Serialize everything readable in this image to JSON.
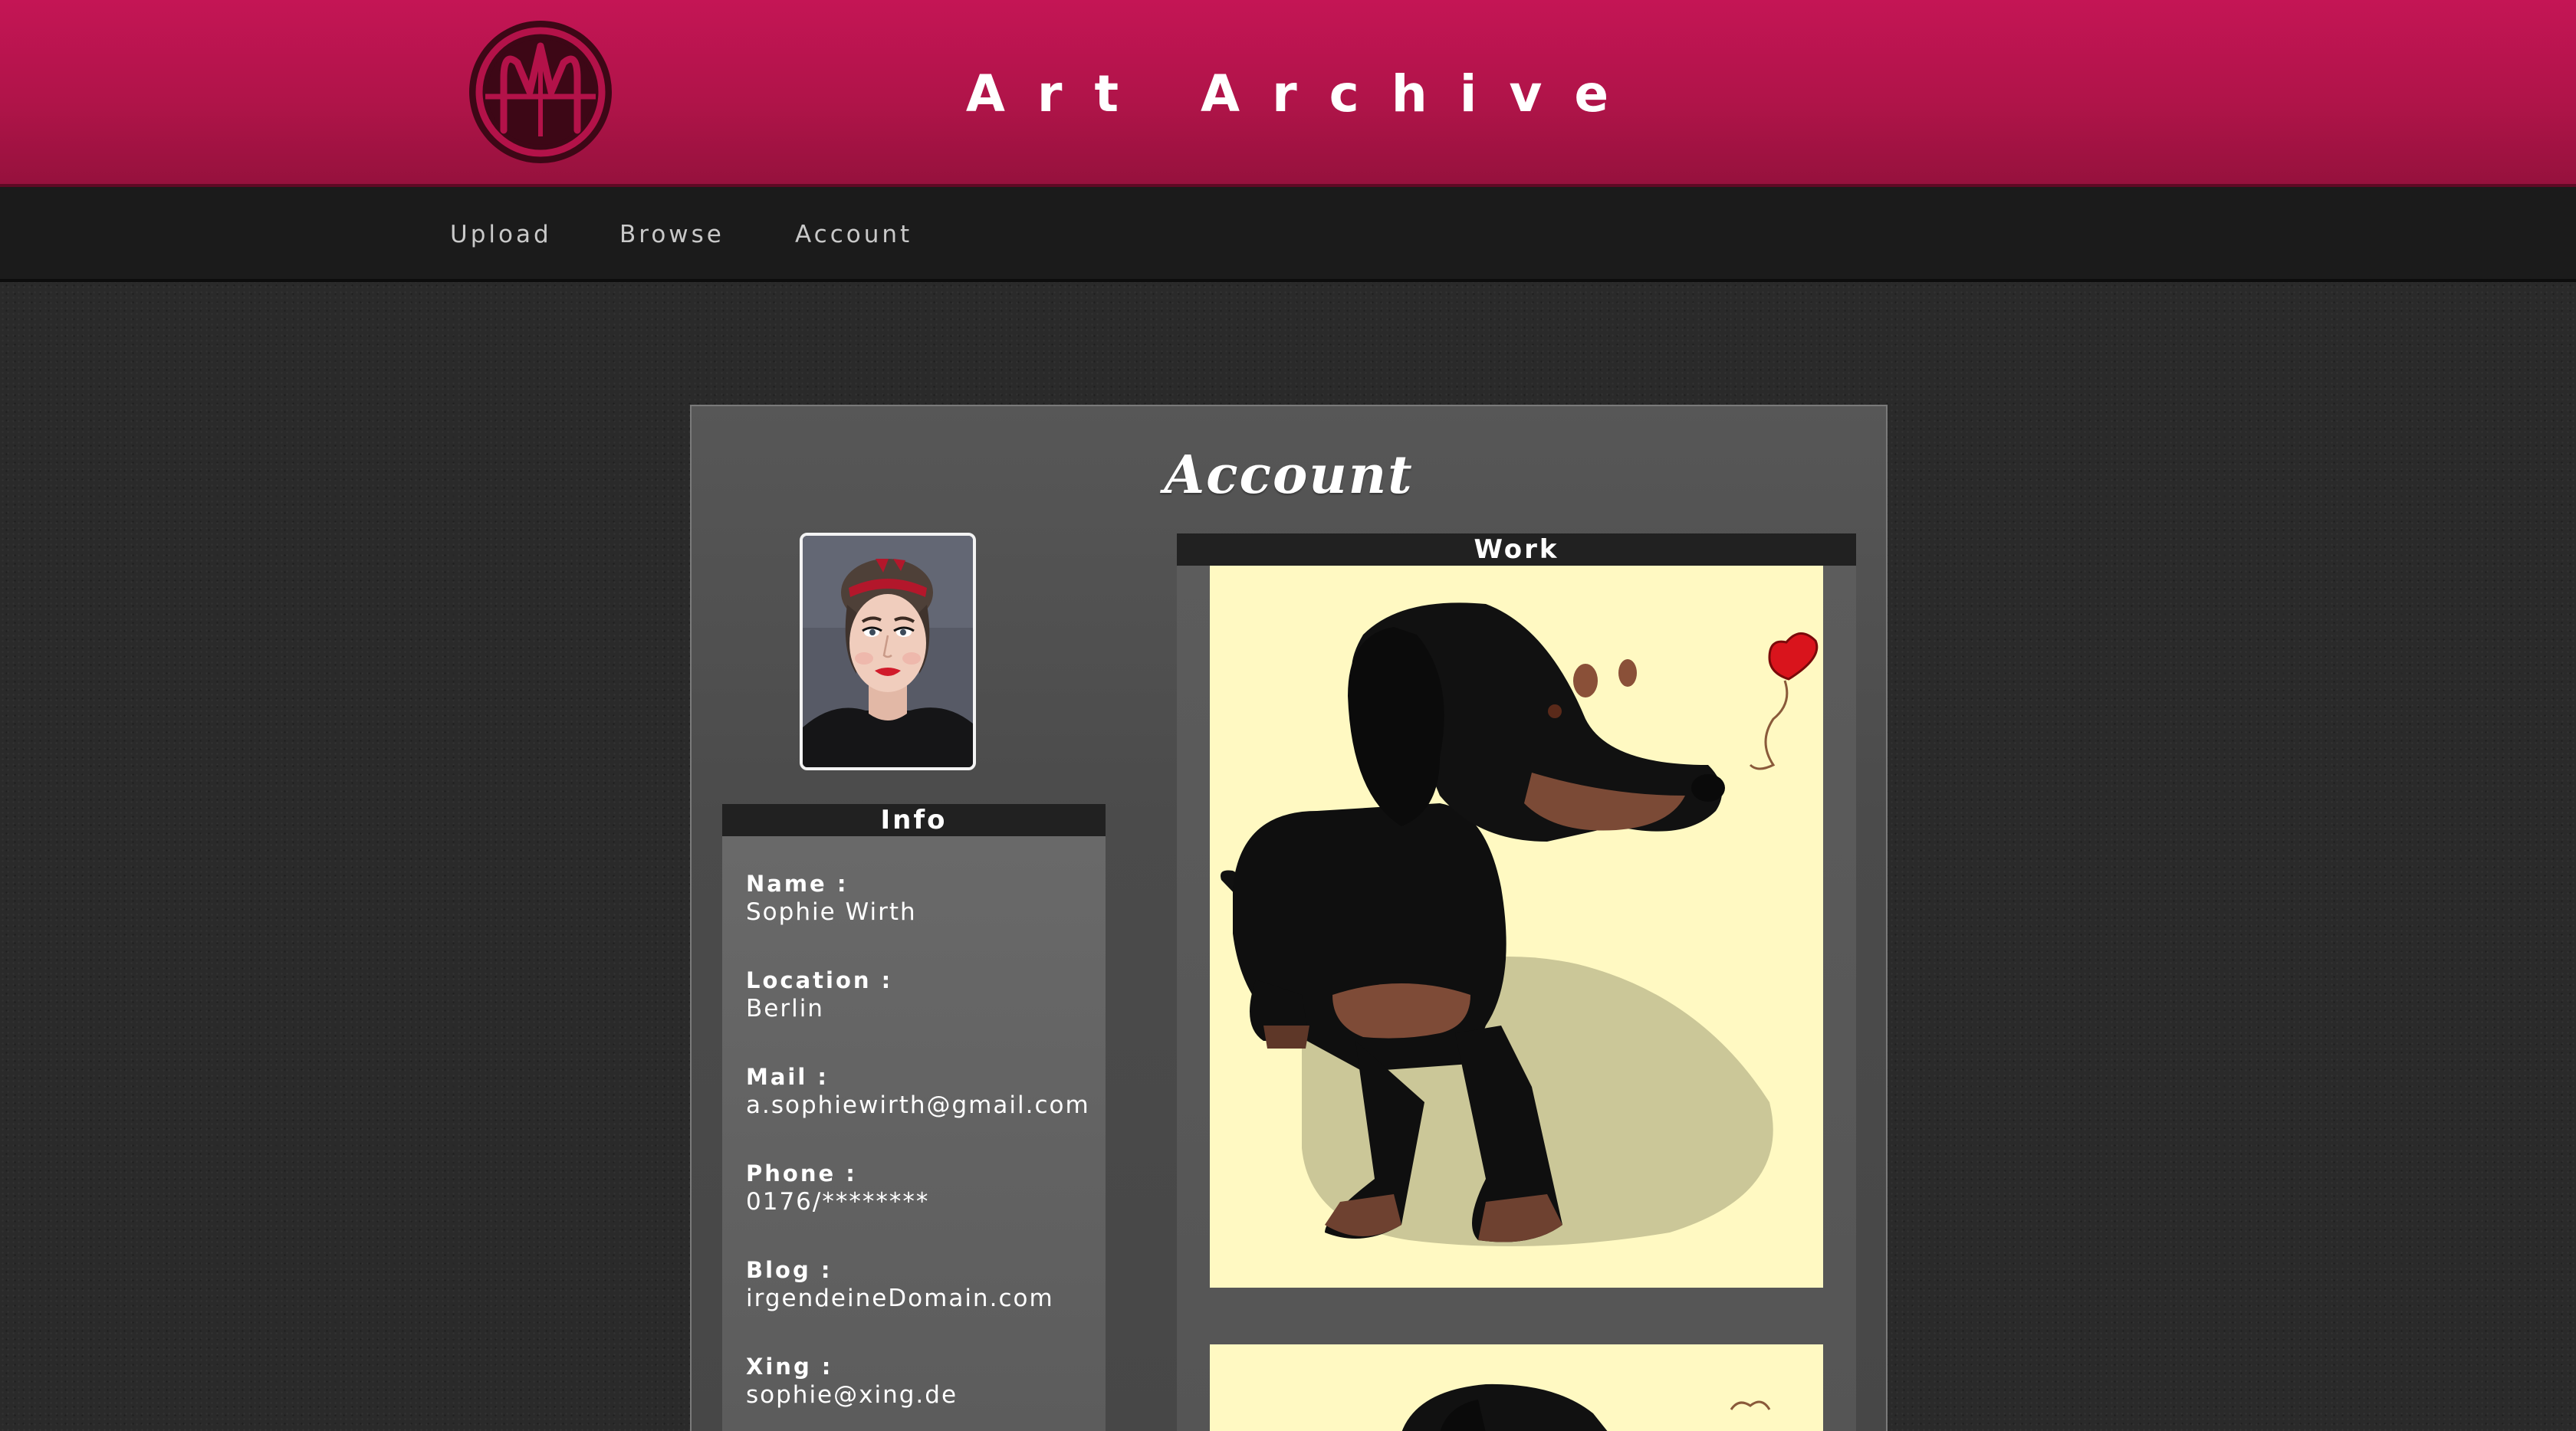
{
  "header": {
    "title": "Art Archive",
    "logo_icon": "art-archive-logo-icon",
    "brand_color": "#c41555"
  },
  "nav": {
    "items": [
      {
        "label": "Upload"
      },
      {
        "label": "Browse"
      },
      {
        "label": "Account"
      }
    ]
  },
  "page": {
    "title": "Account"
  },
  "profile": {
    "avatar": "profile-photo"
  },
  "info": {
    "heading": "Info",
    "fields": [
      {
        "label": "Name :",
        "value": "Sophie Wirth"
      },
      {
        "label": "Location :",
        "value": "Berlin"
      },
      {
        "label": "Mail :",
        "value": "a.sophiewirth@gmail.com"
      },
      {
        "label": "Phone :",
        "value": "0176/********"
      },
      {
        "label": "Blog :",
        "value": "irgendeineDomain.com"
      },
      {
        "label": "Xing :",
        "value": "sophie@xing.de"
      }
    ]
  },
  "work": {
    "heading": "Work",
    "items": [
      {
        "subject": "dachshund-illustration-with-heart"
      },
      {
        "subject": "dachshund-illustration"
      }
    ]
  }
}
